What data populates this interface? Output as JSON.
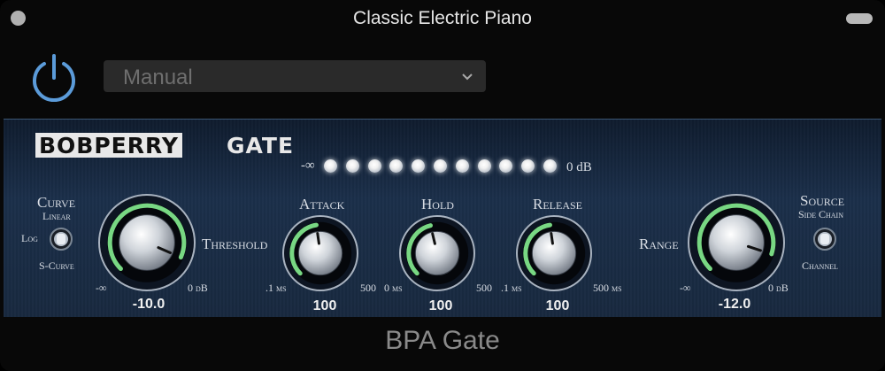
{
  "window": {
    "title": "Classic Electric Piano"
  },
  "header": {
    "preset_value": "Manual"
  },
  "plugin": {
    "brand": "BOBPERRY",
    "name": "GATE",
    "meter": {
      "min_label": "-∞",
      "max_label": "0 dB",
      "led_count": 11
    },
    "curve": {
      "label": "Curve",
      "option_top": "Linear",
      "option_left": "Log",
      "option_bottom": "S-Curve"
    },
    "threshold": {
      "label": "Threshold",
      "min": "-∞",
      "max": "0 dB",
      "value": "-10.0",
      "fraction": 0.92
    },
    "attack": {
      "label": "Attack",
      "min": ".1 ms",
      "max": "500",
      "value": "100",
      "fraction": 0.47
    },
    "hold": {
      "label": "Hold",
      "min": "0 ms",
      "max": "500",
      "value": "100",
      "fraction": 0.45
    },
    "release": {
      "label": "Release",
      "min": ".1 ms",
      "max": "500 ms",
      "value": "100",
      "fraction": 0.47
    },
    "range": {
      "label": "Range",
      "min": "-∞",
      "max": "0 dB",
      "value": "-12.0",
      "fraction": 0.9
    },
    "source": {
      "label": "Source",
      "option_top": "Side Chain",
      "option_bottom": "Channel"
    },
    "colors": {
      "arc_green": "#7ee38a",
      "panel": "#1b2f4a"
    }
  },
  "footer": {
    "label": "BPA Gate"
  }
}
